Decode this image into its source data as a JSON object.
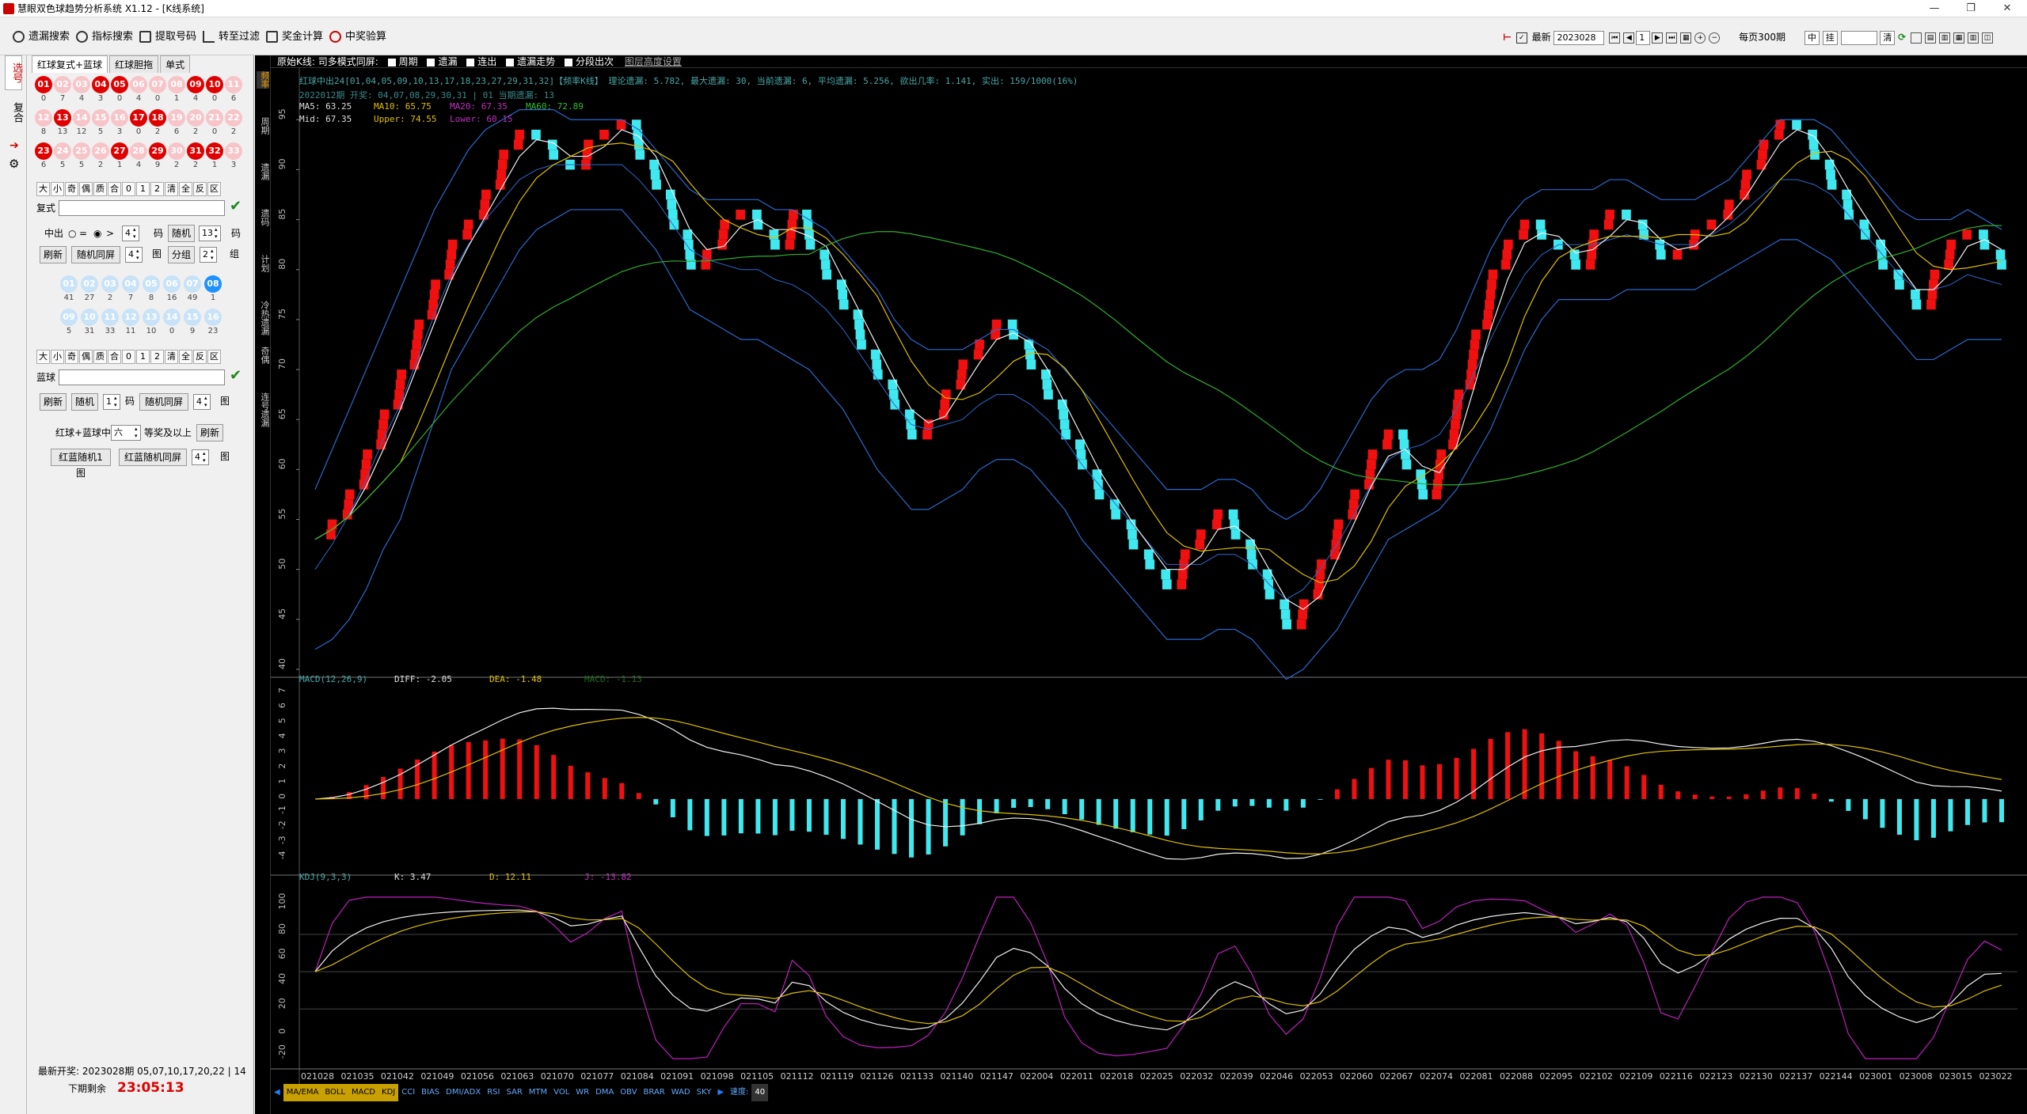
{
  "window": {
    "title": "慧眼双色球趋势分析系统 X1.12 - [K线系统]"
  },
  "toolbar": {
    "left": [
      "遗漏搜索",
      "指标搜索",
      "提取号码",
      "转至过滤",
      "奖金计算",
      "中奖验算"
    ],
    "latest_label": "最新",
    "period": "2023028",
    "per_page": "每页300期",
    "btn_zhong": "中",
    "btn_gua": "挂",
    "btn_qing": "清"
  },
  "vtabs": [
    "选号",
    "复合"
  ],
  "left": {
    "tabs": [
      "红球复式+蓝球",
      "红球胆拖",
      "单式"
    ],
    "red_balls": [
      {
        "n": "01",
        "s": "r",
        "c": "0"
      },
      {
        "n": "02",
        "s": "p",
        "c": "7"
      },
      {
        "n": "03",
        "s": "p",
        "c": "4"
      },
      {
        "n": "04",
        "s": "r",
        "c": "3"
      },
      {
        "n": "05",
        "s": "r",
        "c": "0"
      },
      {
        "n": "06",
        "s": "p",
        "c": "4"
      },
      {
        "n": "07",
        "s": "p",
        "c": "0"
      },
      {
        "n": "08",
        "s": "p",
        "c": "1"
      },
      {
        "n": "09",
        "s": "r",
        "c": "4"
      },
      {
        "n": "10",
        "s": "r",
        "c": "0"
      },
      {
        "n": "11",
        "s": "p",
        "c": "6"
      },
      {
        "n": "12",
        "s": "p",
        "c": "8"
      },
      {
        "n": "13",
        "s": "r",
        "c": "13"
      },
      {
        "n": "14",
        "s": "p",
        "c": "12"
      },
      {
        "n": "15",
        "s": "p",
        "c": "5"
      },
      {
        "n": "16",
        "s": "p",
        "c": "3"
      },
      {
        "n": "17",
        "s": "r",
        "c": "0"
      },
      {
        "n": "18",
        "s": "r",
        "c": "2"
      },
      {
        "n": "19",
        "s": "p",
        "c": "6"
      },
      {
        "n": "20",
        "s": "p",
        "c": "2"
      },
      {
        "n": "21",
        "s": "p",
        "c": "0"
      },
      {
        "n": "22",
        "s": "p",
        "c": "2"
      },
      {
        "n": "23",
        "s": "r",
        "c": "6"
      },
      {
        "n": "24",
        "s": "p",
        "c": "5"
      },
      {
        "n": "25",
        "s": "p",
        "c": "5"
      },
      {
        "n": "26",
        "s": "p",
        "c": "2"
      },
      {
        "n": "27",
        "s": "r",
        "c": "1"
      },
      {
        "n": "28",
        "s": "p",
        "c": "4"
      },
      {
        "n": "29",
        "s": "r",
        "c": "9"
      },
      {
        "n": "30",
        "s": "p",
        "c": "2"
      },
      {
        "n": "31",
        "s": "r",
        "c": "2"
      },
      {
        "n": "32",
        "s": "r",
        "c": "1"
      },
      {
        "n": "33",
        "s": "p",
        "c": "3"
      }
    ],
    "grp1": [
      "大",
      "小",
      "奇",
      "偶",
      "质",
      "合",
      "0",
      "1",
      "2",
      "清",
      "全",
      "反",
      "区"
    ],
    "fushi": "复式",
    "zhongchu": "中出",
    "eq": "=",
    "gt": ">",
    "ma": "码",
    "rand": "随机",
    "rand_count": "13",
    "zhong_val": "4",
    "refresh": "刷新",
    "rand_tongping": "随机同屏",
    "tu": "图",
    "tu_val": "4",
    "fenzu": "分组",
    "zu_val": "2",
    "zu": "组",
    "blue_balls": [
      {
        "n": "01",
        "s": "lb",
        "c": "41"
      },
      {
        "n": "02",
        "s": "lb",
        "c": "27"
      },
      {
        "n": "03",
        "s": "lb",
        "c": "2"
      },
      {
        "n": "04",
        "s": "lb",
        "c": "7"
      },
      {
        "n": "05",
        "s": "lb",
        "c": "8"
      },
      {
        "n": "06",
        "s": "lb",
        "c": "16"
      },
      {
        "n": "07",
        "s": "lb",
        "c": "49"
      },
      {
        "n": "08",
        "s": "b",
        "c": "1"
      },
      {
        "n": "09",
        "s": "lb",
        "c": "5"
      },
      {
        "n": "10",
        "s": "lb",
        "c": "31"
      },
      {
        "n": "11",
        "s": "lb",
        "c": "33"
      },
      {
        "n": "12",
        "s": "lb",
        "c": "11"
      },
      {
        "n": "13",
        "s": "lb",
        "c": "10"
      },
      {
        "n": "14",
        "s": "lb",
        "c": "0"
      },
      {
        "n": "15",
        "s": "lb",
        "c": "9"
      },
      {
        "n": "16",
        "s": "lb",
        "c": "23"
      }
    ],
    "lanqiu": "蓝球",
    "blue_rand_val": "1",
    "blue_tu_val": "4",
    "red_blue": "红球+蓝球中",
    "liu": "六",
    "prize_above": "等奖及以上",
    "rb_rand1": "红蓝随机1图",
    "rb_rand_tp": "红蓝随机同屏",
    "rb_tu_val": "4",
    "last_draw_label": "最新开奖:",
    "last_draw": "2023028期 05,07,10,17,20,22 | 14",
    "remain_label": "下期剩余",
    "remain": "23:05:13"
  },
  "side_strip": [
    "频率",
    "周期",
    "遗漏",
    "遗码",
    "计划",
    "冷热遗漏",
    "奇偶",
    "连号遗漏"
  ],
  "chart": {
    "top_label": "原始K线: 司多模式同屏:",
    "opts": [
      "周期",
      "遗漏",
      "连出",
      "遗漏走势",
      "分段出次"
    ],
    "opts_link": "图层高度设置",
    "info1": "红球中出24[01,04,05,09,10,13,17,18,23,27,29,31,32]【频率K线】 理论遗漏: 5.782, 最大遗漏: 30, 当前遗漏: 6, 平均遗漏: 5.256, 欲出几率: 1.141, 实出: 159/1000(16%)",
    "info2": "2022012期 开奖: 04,07,08,29,30,31 | 01 当期遗漏: 13",
    "ma5": "MA5: 63.25",
    "ma10": "MA10: 65.75",
    "ma20": "MA20: 67.35",
    "ma60": "MA60: 72.89",
    "mid": "Mid: 67.35",
    "upper": "Upper: 74.55",
    "lower": "Lower: 60.15",
    "macd_title": "MACD(12,26,9)",
    "diff": "DIFF: -2.05",
    "dea": "DEA: -1.48",
    "macd": "MACD: -1.13",
    "kdj_title": "KDJ(9,3,3)",
    "k": "K: 3.47",
    "d": "D: 12.11",
    "j": "J: -13.82",
    "xticks": [
      "021028",
      "021035",
      "021042",
      "021049",
      "021056",
      "021063",
      "021070",
      "021077",
      "021084",
      "021091",
      "021098",
      "021105",
      "021112",
      "021119",
      "021126",
      "021133",
      "021140",
      "021147",
      "022004",
      "022011",
      "022018",
      "022025",
      "022032",
      "022039",
      "022046",
      "022053",
      "022060",
      "022067",
      "022074",
      "022081",
      "022088",
      "022095",
      "022102",
      "022109",
      "022116",
      "022123",
      "022130",
      "022137",
      "022144",
      "023001",
      "023008",
      "023015",
      "023022"
    ],
    "bottom_tabs": [
      "MA/EMA",
      "BOLL",
      "MACD",
      "KDJ",
      "CCI",
      "BIAS",
      "DMI/ADX",
      "RSI",
      "SAR",
      "MTM",
      "VOL",
      "WR",
      "DMA",
      "OBV",
      "BRAR",
      "WAD",
      "SKY"
    ],
    "speed_label": "速度:",
    "speed": "40"
  },
  "chart_data": {
    "type": "line",
    "main": {
      "ylim": [
        40,
        97
      ],
      "yticks": [
        40,
        45,
        50,
        55,
        60,
        65,
        70,
        75,
        80,
        85,
        90,
        95
      ],
      "close": [
        53,
        55,
        58,
        62,
        66,
        70,
        75,
        79,
        83,
        85,
        88,
        92,
        94,
        93,
        91,
        90,
        93,
        94,
        95,
        91,
        88,
        84,
        80,
        82,
        85,
        86,
        84,
        82,
        86,
        82,
        79,
        76,
        72,
        69,
        66,
        63,
        65,
        68,
        71,
        73,
        75,
        73,
        70,
        67,
        63,
        60,
        57,
        55,
        52,
        50,
        48,
        52,
        54,
        56,
        53,
        50,
        47,
        44,
        47,
        51,
        55,
        58,
        62,
        64,
        60,
        57,
        62,
        68,
        74,
        80,
        83,
        85,
        83,
        82,
        80,
        84,
        86,
        85,
        83,
        81,
        82,
        84,
        85,
        87,
        90,
        93,
        95,
        94,
        91,
        88,
        85,
        83,
        80,
        78,
        76,
        80,
        83,
        84,
        82,
        80
      ],
      "upper": [
        58,
        62,
        66,
        70,
        74,
        78,
        82,
        86,
        89,
        92,
        94,
        95,
        96,
        96,
        96,
        95,
        95,
        95,
        95,
        94,
        92,
        90,
        88,
        87,
        87,
        87,
        87,
        86,
        86,
        85,
        84,
        82,
        80,
        78,
        75,
        73,
        72,
        72,
        72,
        73,
        74,
        74,
        73,
        72,
        70,
        68,
        66,
        64,
        62,
        60,
        58,
        58,
        58,
        59,
        59,
        58,
        56,
        55,
        56,
        58,
        61,
        64,
        67,
        69,
        70,
        70,
        71,
        74,
        78,
        82,
        85,
        87,
        88,
        88,
        88,
        88,
        89,
        89,
        88,
        87,
        87,
        87,
        88,
        89,
        91,
        93,
        95,
        95,
        95,
        94,
        92,
        90,
        88,
        86,
        85,
        85,
        85,
        86,
        85,
        84
      ],
      "lower": [
        42,
        43,
        45,
        48,
        52,
        55,
        60,
        65,
        70,
        73,
        76,
        79,
        82,
        84,
        85,
        86,
        86,
        86,
        86,
        84,
        82,
        79,
        76,
        75,
        74,
        73,
        73,
        72,
        71,
        70,
        68,
        66,
        63,
        60,
        58,
        56,
        56,
        57,
        58,
        60,
        61,
        61,
        60,
        58,
        56,
        53,
        51,
        49,
        47,
        45,
        43,
        43,
        43,
        44,
        44,
        43,
        41,
        39,
        40,
        42,
        44,
        47,
        50,
        53,
        54,
        55,
        56,
        58,
        61,
        64,
        68,
        72,
        75,
        77,
        77,
        77,
        77,
        78,
        78,
        78,
        78,
        78,
        79,
        80,
        81,
        82,
        83,
        83,
        82,
        81,
        79,
        77,
        75,
        73,
        71,
        71,
        72,
        73,
        73,
        73
      ]
    },
    "macd": {
      "ylim": [
        -4.5,
        7
      ],
      "yticks": [
        -4,
        -3,
        -2,
        -1,
        0,
        1,
        2,
        3,
        4,
        5,
        6,
        7
      ]
    },
    "kdj": {
      "ylim": [
        -25,
        115
      ],
      "yticks": [
        -20,
        0,
        20,
        40,
        60,
        80,
        100
      ]
    }
  }
}
